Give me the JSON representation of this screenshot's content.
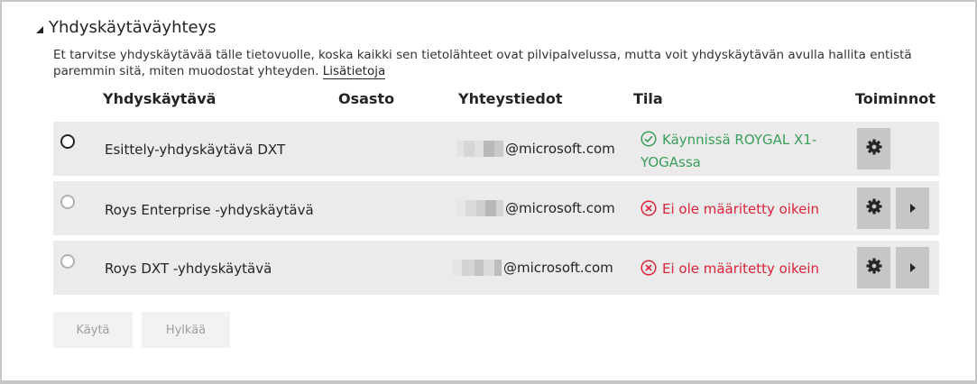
{
  "section": {
    "title": "Yhdyskäytäväyhteys",
    "description": "Et tarvitse yhdyskäytävää tälle tietovuolle, koska kaikki sen tietolähteet ovat pilvipalvelussa, mutta voit yhdyskäytävän avulla hallita entistä paremmin sitä, miten muodostat yhteyden.",
    "learn_more": "Lisätietoja"
  },
  "columns": {
    "gateway": "Yhdyskäytävä",
    "department": "Osasto",
    "contact": "Yhteystiedot",
    "status": "Tila",
    "actions": "Toiminnot"
  },
  "rows": [
    {
      "name": "Esittely-yhdyskäytävä DXT",
      "contact_domain": "@microsoft.com",
      "status_line1": "Käynnissä ROYGAL X1-",
      "status_line2": "YOGAssa",
      "status_type": "ok",
      "selected": true
    },
    {
      "name": "Roys Enterprise -yhdyskäytävä",
      "contact_domain": "@microsoft.com",
      "status_line1": "Ei ole määritetty oikein",
      "status_line2": "",
      "status_type": "error",
      "selected": false
    },
    {
      "name": "Roys DXT -yhdyskäytävä",
      "contact_domain": "@microsoft.com",
      "status_line1": "Ei ole määritetty oikein",
      "status_line2": "",
      "status_type": "error",
      "selected": false
    }
  ],
  "buttons": {
    "apply": "Käytä",
    "discard": "Hylkää"
  },
  "colors": {
    "ok": "#3c9e5a",
    "error": "#d9243a",
    "row_bg": "#ebebeb",
    "action_bg": "#c8c6c4"
  },
  "icons": {
    "collapse": "caret-down-icon",
    "radio": "radio-icon",
    "status_ok": "check-circle-icon",
    "status_error": "x-circle-icon",
    "settings": "gear-icon",
    "expand": "chevron-right-icon"
  }
}
